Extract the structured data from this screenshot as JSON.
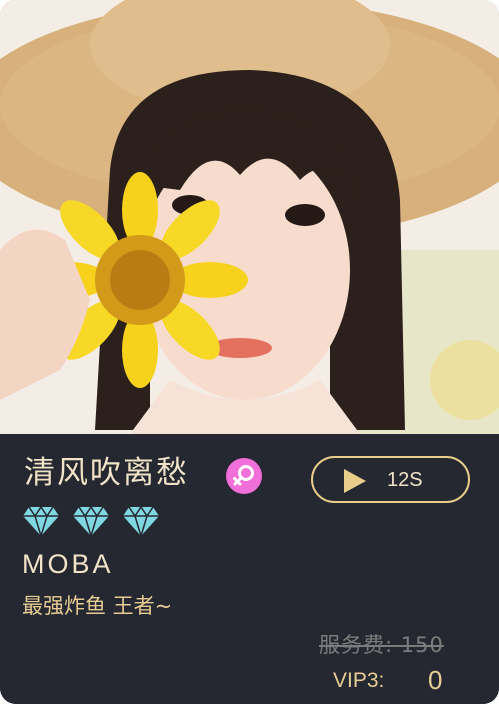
{
  "profile": {
    "name": "清风吹离愁",
    "gender_icon": "female-symbol-icon",
    "gender_color": "#f06fd8",
    "rank_icon": "diamond-icon",
    "rank_count": 3,
    "game": "MOBA",
    "tagline": "最强炸鱼 王者~"
  },
  "voice": {
    "icon": "play-icon",
    "duration": "12S"
  },
  "pricing": {
    "original": "服务费: 150",
    "vip_label": "VIP3:",
    "vip_price": "0"
  },
  "colors": {
    "panel": "#252830",
    "accent": "#e9cd8a",
    "diamond": "#7fd7e2"
  }
}
